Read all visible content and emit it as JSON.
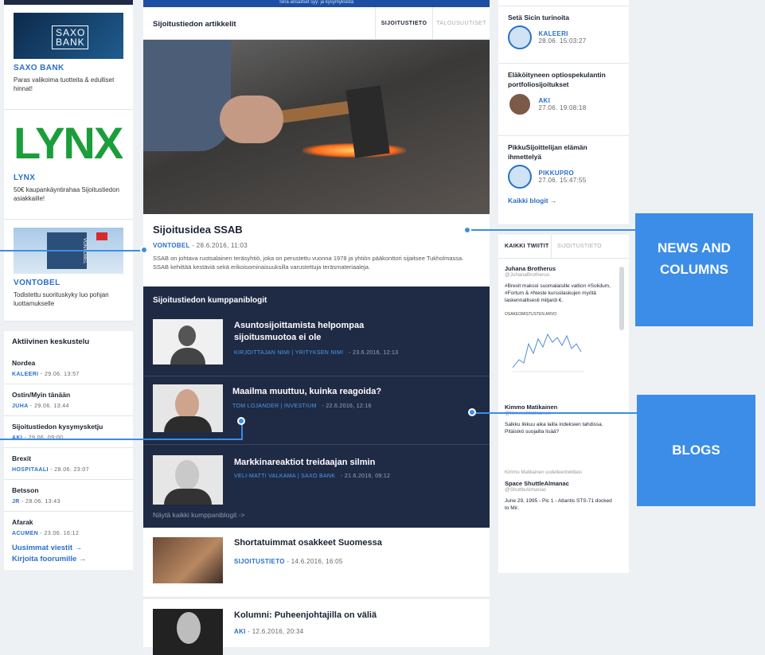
{
  "top_banner": "Sinä ansaitset syy: ja kysymyksistä",
  "left": {
    "ads": [
      {
        "name": "SAXO BANK",
        "logo": "SAXO BANK",
        "desc": "Paras valikoima tuotteita & edulliset hinnat!"
      },
      {
        "name": "LYNX",
        "logo": "LYNX",
        "desc": "50€ kaupankäyntirahaa Sijoitustiedon asiakkaille!"
      },
      {
        "name": "VONTOBEL",
        "logo": "VONTOBEL",
        "desc": "Todistettu suorituskyky luo pohjan luottamukselle"
      }
    ],
    "discussion_title": "Aktiivinen keskustelu",
    "discussions": [
      {
        "title": "Nordea",
        "author": "KALEERI",
        "time": " - 29.06. 13:57"
      },
      {
        "title": "Ostin/Myin tänään",
        "author": "JUHA",
        "time": " - 29.06. 13:44"
      },
      {
        "title": "Sijoitustiedon kysymysketju",
        "author": "AKI",
        "time": " - 29.06. 09:00"
      },
      {
        "title": "Brexit",
        "author": "HOSPITAALI",
        "time": " - 28.06. 23:07"
      },
      {
        "title": "Betsson",
        "author": "JR",
        "time": " - 28.06. 13:43"
      },
      {
        "title": "Afarak",
        "author": "ACUMEN",
        "time": " - 23.06. 16:12"
      }
    ],
    "links": [
      "Uusimmat viestit →",
      "Kirjoita foorumille →"
    ]
  },
  "mid": {
    "section_title": "Sijoitustiedon artikkelit",
    "tabs": [
      "SIJOITUSTIETO",
      "TALOUSUUTISET"
    ],
    "article_title": "Sijoitusidea SSAB",
    "article_author": "VONTOBEL",
    "article_time": " - 28.6.2016, 11:03",
    "article_body": "SSAB on johtava ruotsalainen teräsyhtiö, joka on perustettu vuonna 1978 ja yhtiön pääkonttori sijaitsee Tukholmassa. SSAB kehittää kestäviä sekä erikoisominaisuuksilla varustettuja teräsmateriaaleja.",
    "partner_title": "Sijoitustiedon kumppaniblogit",
    "blogs": [
      {
        "title": "Asuntosijoittamista helpompaa sijoitusmuotoa ei ole",
        "meta": "KIRJOITTAJAN NIMI | YRITYKSEN NIMI",
        "time": "- 23.6.2016, 12:13"
      },
      {
        "title": "Maailma muuttuu, kuinka reagoida?",
        "meta": "TOM LOJANDER | INVESTIUM",
        "time": "- 22.6.2016, 12:16"
      },
      {
        "title": "Markkinareaktiot treidaajan silmin",
        "meta": "VELI-MATTI VALKAMA | SAXO BANK",
        "time": "- 21.6.2016, 09:12"
      }
    ],
    "show_all": "Näytä kaikki kumppaniblogit ->",
    "articles": [
      {
        "title": "Shortatuimmat osakkeet Suomessa",
        "author": "SIJOITUSTIETO",
        "time": " - 14.6.2016, 16:05"
      },
      {
        "title": "Kolumni: Puheenjohtajilla on väliä",
        "author": "AKI",
        "time": " - 12.6.2016, 20:34"
      }
    ]
  },
  "right": {
    "blogs": [
      {
        "title": "Setä Sicin turinoita",
        "author": "KALEERI",
        "time": "28.06. 15:03:27"
      },
      {
        "title": "Eläköityneen optiospekulantin portfoliosijoitukset",
        "author": "AKI",
        "time": "27.06. 19:08:18"
      },
      {
        "title": "PikkuSijoittelijan elämän ihmettelyä",
        "author": "PIKKUPRO",
        "time": "27.06. 15:47:55"
      }
    ],
    "all_blogs": "Kaikki blogit →",
    "tweet_tabs": [
      "KAIKKI TWIITIT",
      "SIJOITUSTIETO"
    ],
    "tweets": [
      {
        "name": "Juhana Brotherus",
        "handle": "@JuhanaBrotherus",
        "text": "#Brexit maksoi suomalaisille valtion #Solidum, #Fortum & #Neste kurssilaskujen myötä laskennallisesti miljardi €.",
        "chart_label": "OSAKEOMISTUSTEN ARVO"
      },
      {
        "name": "Kimmo Matikainen",
        "handle": "@KimmoMatikainen",
        "text": "Salkku likkuu aika lailla indeksien tahdissa. Pitäisikö suojailla lisää?"
      },
      {
        "name": "Space ShuttleAlmanac",
        "handle": "@ShuttleAlmanac",
        "retweet": "Kimmo Matikainen uudelleentwiittasi",
        "text": "June 29, 1995 - Pic 1 - Atlantis STS-71 docked to Mir."
      }
    ]
  },
  "callouts": [
    "NEWS AND COLUMNS",
    "BLOGS"
  ],
  "colors": {
    "navy": "#1f2a44",
    "blue": "#2a6fc9",
    "callout": "#3b8de8"
  }
}
